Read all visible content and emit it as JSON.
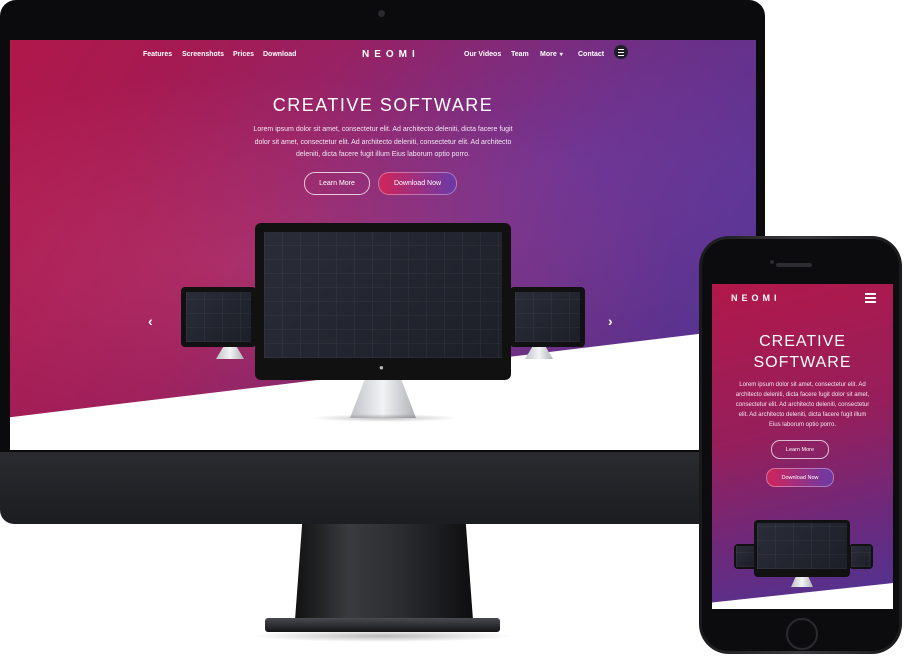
{
  "desktop": {
    "nav": {
      "left_items": [
        "Features",
        "Screenshots",
        "Prices",
        "Download"
      ],
      "logo": "NEOMI",
      "right_items": [
        "Our Videos",
        "Team",
        "More",
        "Contact"
      ],
      "more_chevron": "▾"
    },
    "hero": {
      "title": "CREATIVE SOFTWARE",
      "description": "Lorem ipsum dolor sit amet, consectetur elit. Ad architecto deleniti, dicta facere fugit dolor sit amet, consectetur elit. Ad architecto deleniti, consectetur elit. Ad architecto deleniti, dicta facere fugit illum Eius laborum optio porro.",
      "learn_more": "Learn More",
      "download_now": "Download Now"
    },
    "carousel": {
      "prev_arrow": "‹",
      "next_arrow": "›"
    }
  },
  "mobile": {
    "logo": "NEOMI",
    "hero": {
      "title_line1": "CREATIVE",
      "title_line2": "SOFTWARE",
      "description": "Lorem ipsum dolor sit amet, consectetur elit. Ad architecto deleniti, dicta facere fugit dolor sit amet, consectetur elit. Ad architecto deleniti, consectetur elit. Ad architecto deleniti, dicta facere fugit illum Eius laborum optio porro.",
      "learn_more": "Learn More",
      "download_now": "Download Now"
    }
  },
  "colors": {
    "brand_magenta": "#b0184a",
    "brand_purple": "#4c3596",
    "button_gradient_start": "#d0245a",
    "button_gradient_end": "#6a3aa6"
  },
  "icons": [
    "menu-icon",
    "chevron-down-icon",
    "arrow-left-icon",
    "arrow-right-icon",
    "apple-logo-icon"
  ]
}
